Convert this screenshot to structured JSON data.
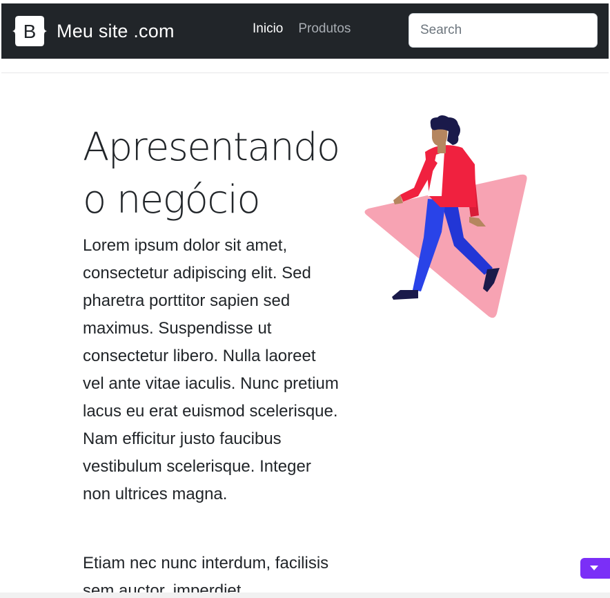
{
  "navbar": {
    "brand_name": "Meu site .com",
    "brand_logo_letter": "B",
    "brand_icon": "bootstrap-logo-icon",
    "links": [
      {
        "label": "Inicio"
      },
      {
        "label": "Produtos"
      }
    ],
    "search": {
      "placeholder": "Search",
      "value": ""
    },
    "background": "#212529"
  },
  "hero": {
    "title": "Apresentando o negócio",
    "paragraphs": [
      "Lorem ipsum dolor sit amet, consectetur adipiscing elit. Sed pharetra porttitor sapien sed maximus. Suspendisse ut consectetur libero. Nulla laoreet vel ante vitae iaculis. Nunc pretium lacus eu erat euismod scelerisque. Nam efficitur justo faucibus vestibulum scelerisque. Integer non ultrices magna.",
      "Etiam nec nunc interdum, facilisis sem auctor, imperdiet"
    ],
    "illustration_icon": "walking-person-illustration",
    "illustration_colors": {
      "triangle": "#f7a3b3",
      "jacket": "#f0213f",
      "pants": "#2943e8",
      "hair": "#1a1a4a",
      "skin": "#b5865f"
    }
  },
  "scroll_button": {
    "icon": "caret-down-icon",
    "color": "#7b2ff7"
  }
}
